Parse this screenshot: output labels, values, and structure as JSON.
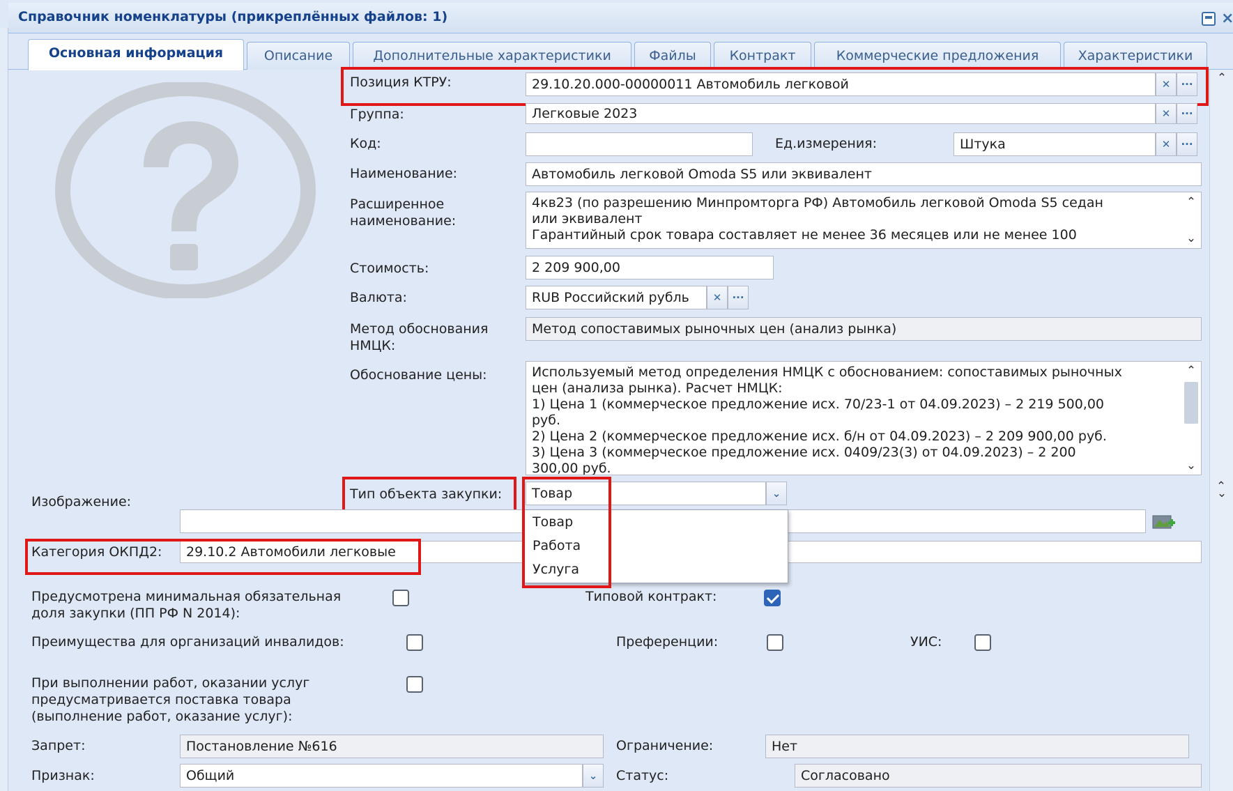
{
  "window": {
    "title": "Справочник номенклатуры (прикреплённых файлов: 1)"
  },
  "tabs": [
    {
      "label": "Основная информация",
      "active": true
    },
    {
      "label": "Описание"
    },
    {
      "label": "Дополнительные характеристики"
    },
    {
      "label": "Файлы"
    },
    {
      "label": "Контракт"
    },
    {
      "label": "Коммерческие предложения"
    },
    {
      "label": "Характеристики"
    }
  ],
  "icons": {
    "placeholder": "question-mark-icon",
    "clear": "×",
    "more": "···",
    "dropdown": "chevron-down-icon",
    "scroll_up": "⌃",
    "scroll_down": "⌄"
  },
  "form": {
    "ktru_label": "Позиция КТРУ:",
    "ktru_value": "29.10.20.000-00000011 Автомобиль легковой",
    "group_label": "Группа:",
    "group_value": "Легковые 2023",
    "code_label": "Код:",
    "code_value": "",
    "unit_label": "Ед.измерения:",
    "unit_value": "Штука",
    "name_label": "Наименование:",
    "name_value": "Автомобиль легковой Omoda S5 или эквивалент",
    "ext_name_label_1": "Расширенное",
    "ext_name_label_2": "наименование:",
    "ext_name_lines": [
      "4кв23 (по разрешению Минпромторга РФ) Автомобиль легковой Omoda S5 седан",
      "или эквивалент",
      "Гарантийный срок товара составляет не менее 36 месяцев или не менее 100"
    ],
    "cost_label": "Стоимость:",
    "cost_value": "2 209 900,00",
    "currency_label": "Валюта:",
    "currency_value": "RUB Российский рубль",
    "method_label_1": "Метод обоснования",
    "method_label_2": "НМЦК:",
    "method_value": "Метод сопоставимых рыночных цен (анализ рынка)",
    "price_reason_label": "Обоснование цены:",
    "price_reason_lines": [
      "Используемый метод определения НМЦК с обоснованием: сопоставимых рыночных",
      "цен (анализа рынка). Расчет НМЦК:",
      "1) Цена 1 (коммерческое предложение исх. 70/23-1 от 04.09.2023) – 2 219 500,00",
      "руб.",
      "2) Цена 2 (коммерческое предложение исх. б/н от 04.09.2023) – 2 209 900,00 руб.",
      "3) Цена 3 (коммерческое предложение исх. 0409/23(3) от 04.09.2023) – 2 200",
      "300,00 руб."
    ],
    "object_type_label": "Тип объекта закупки:",
    "object_type_value": "Товар",
    "object_type_options": [
      "Товар",
      "Работа",
      "Услуга"
    ],
    "image_label": "Изображение:",
    "okpd_label": "Категория ОКПД2:",
    "okpd_value": "29.10.2 Автомобили легковые",
    "min_share_label_1": "Предусмотрена минимальная обязательная",
    "min_share_label_2": "доля закупки (ПП РФ N 2014):",
    "min_share_checked": false,
    "typical_contract_label": "Типовой контракт:",
    "typical_contract_checked": true,
    "disabled_orgs_label": "Преимущества для организаций инвалидов:",
    "disabled_orgs_checked": false,
    "preferences_label": "Преференции:",
    "preferences_checked": false,
    "uis_label": "УИС:",
    "uis_checked": false,
    "supply_label_1": "При выполнении работ, оказании услуг",
    "supply_label_2": "предусматривается поставка товара",
    "supply_label_3": "(выполнение работ, оказание услуг):",
    "supply_checked": false,
    "ban_label": "Запрет:",
    "ban_value": "Постановление №616",
    "restriction_label": "Ограничение:",
    "restriction_value": "Нет",
    "sign_label": "Признак:",
    "sign_value": "Общий",
    "status_label": "Статус:",
    "status_value": "Согласовано"
  },
  "colors": {
    "background": "#dfe8f6",
    "highlight": "#e01717",
    "title": "#15428b"
  }
}
